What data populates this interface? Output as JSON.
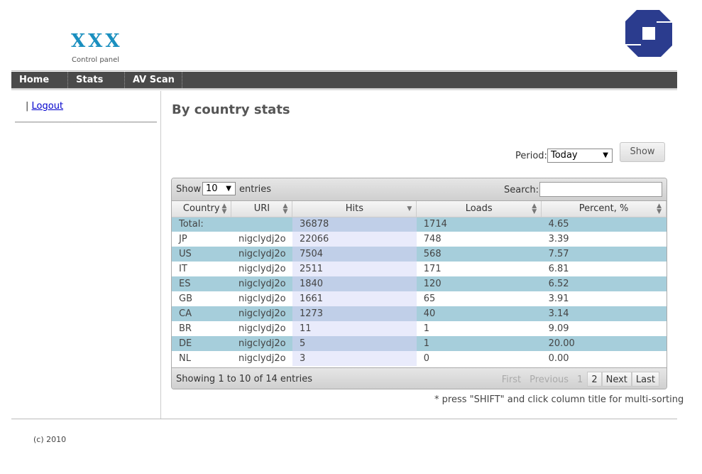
{
  "header": {
    "logo_text": "XXX",
    "logo_sub": "Control panel",
    "brand_color": "#2b3c8e"
  },
  "nav": {
    "items": [
      "Home",
      "Stats",
      "AV Scan"
    ]
  },
  "sidebar": {
    "separator": "|",
    "logout": "Logout"
  },
  "page": {
    "title": "By country stats"
  },
  "period": {
    "label": "Period:",
    "selected": "Today",
    "show_button": "Show"
  },
  "table": {
    "length_label": "Show",
    "length_value": "10",
    "length_after": "entries",
    "search_label": "Search:",
    "search_value": "",
    "columns": [
      "Country",
      "URI",
      "Hits",
      "Loads",
      "Percent, %"
    ],
    "rows": [
      [
        "Total:",
        "",
        "36878",
        "1714",
        "4.65"
      ],
      [
        "JP",
        "nigclydj2o",
        "22066",
        "748",
        "3.39"
      ],
      [
        "US",
        "nigclydj2o",
        "7504",
        "568",
        "7.57"
      ],
      [
        "IT",
        "nigclydj2o",
        "2511",
        "171",
        "6.81"
      ],
      [
        "ES",
        "nigclydj2o",
        "1840",
        "120",
        "6.52"
      ],
      [
        "GB",
        "nigclydj2o",
        "1661",
        "65",
        "3.91"
      ],
      [
        "CA",
        "nigclydj2o",
        "1273",
        "40",
        "3.14"
      ],
      [
        "BR",
        "nigclydj2o",
        "11",
        "1",
        "9.09"
      ],
      [
        "DE",
        "nigclydj2o",
        "5",
        "1",
        "20.00"
      ],
      [
        "NL",
        "nigclydj2o",
        "3",
        "0",
        "0.00"
      ]
    ],
    "info": "Showing 1 to 10 of 14 entries",
    "pager": {
      "first": "First",
      "previous": "Previous",
      "pages": [
        "1",
        "2"
      ],
      "next": "Next",
      "last": "Last"
    }
  },
  "note": "* press \"SHIFT\" and click column title for multi-sorting",
  "footer": {
    "copyright": "(c) 2010"
  },
  "colors": {
    "accent": "#1a8fbf",
    "row_odd": "#a6cedb",
    "sorted_col": "#c0cfe8",
    "navbar": "#4a4a4a"
  }
}
